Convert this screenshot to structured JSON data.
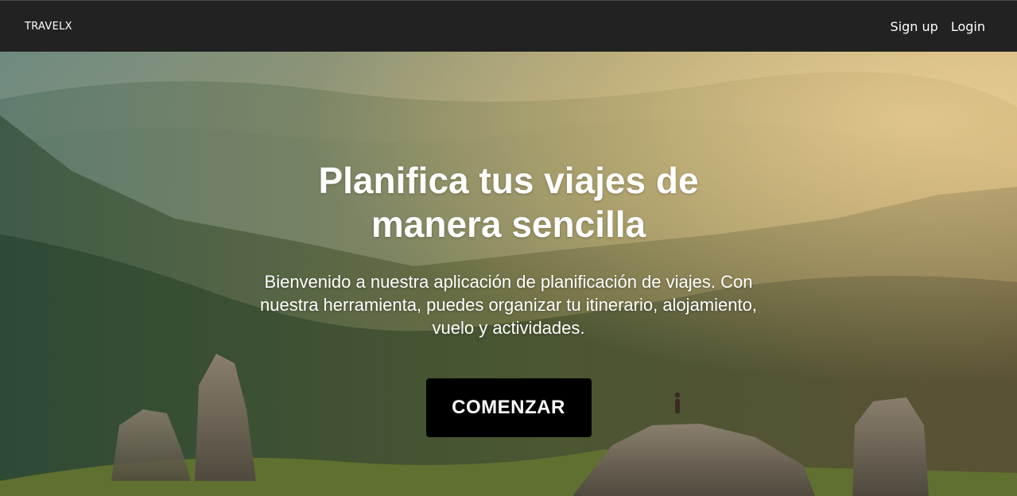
{
  "navbar": {
    "brand": "TRAVELX",
    "links": [
      {
        "label": "Sign up"
      },
      {
        "label": "Login"
      }
    ]
  },
  "hero": {
    "title": "Planifica tus viajes de manera sencilla",
    "description": "Bienvenido a nuestra aplicación de planificación de viajes. Con nuestra herramienta, puedes organizar tu itinerario, alojamiento, vuelo y actividades.",
    "cta_label": "COMENZAR",
    "background_description": "mountain-landscape-photo"
  },
  "colors": {
    "navbar_bg": "#222222",
    "cta_bg": "#000000",
    "text": "#ffffff"
  }
}
